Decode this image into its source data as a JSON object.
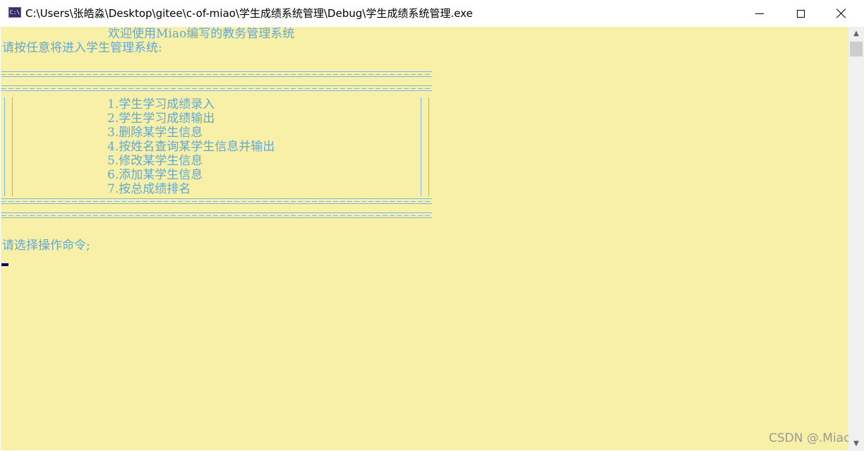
{
  "window": {
    "icon_text": "C:\\",
    "title": "C:\\Users\\张皓淼\\Desktop\\gitee\\c-of-miao\\学生成绩系统管理\\Debug\\学生成绩系统管理.exe"
  },
  "console": {
    "welcome": "欢迎使用Miao编写的教务管理系统",
    "press_any_key": "请按任意将进入学生管理系统:",
    "menu": [
      "1.学生学习成绩录入",
      "2.学生学习成绩输出",
      "3.删除某学生信息",
      "4.按姓名查询某学生信息并输出",
      "5.修改某学生信息",
      "6.添加某学生信息",
      "7.按总成绩排名"
    ],
    "prompt": "请选择操作命令;"
  },
  "watermark": "CSDN @.Miao",
  "colors": {
    "console_bg": "#f9f0a7",
    "console_text": "#5fa8d8",
    "cursor": "#000066"
  },
  "icons": {
    "minimize": "minimize-icon",
    "maximize": "maximize-icon",
    "close": "close-icon",
    "scroll_up": "chevron-up-icon",
    "scroll_down": "chevron-down-icon"
  }
}
